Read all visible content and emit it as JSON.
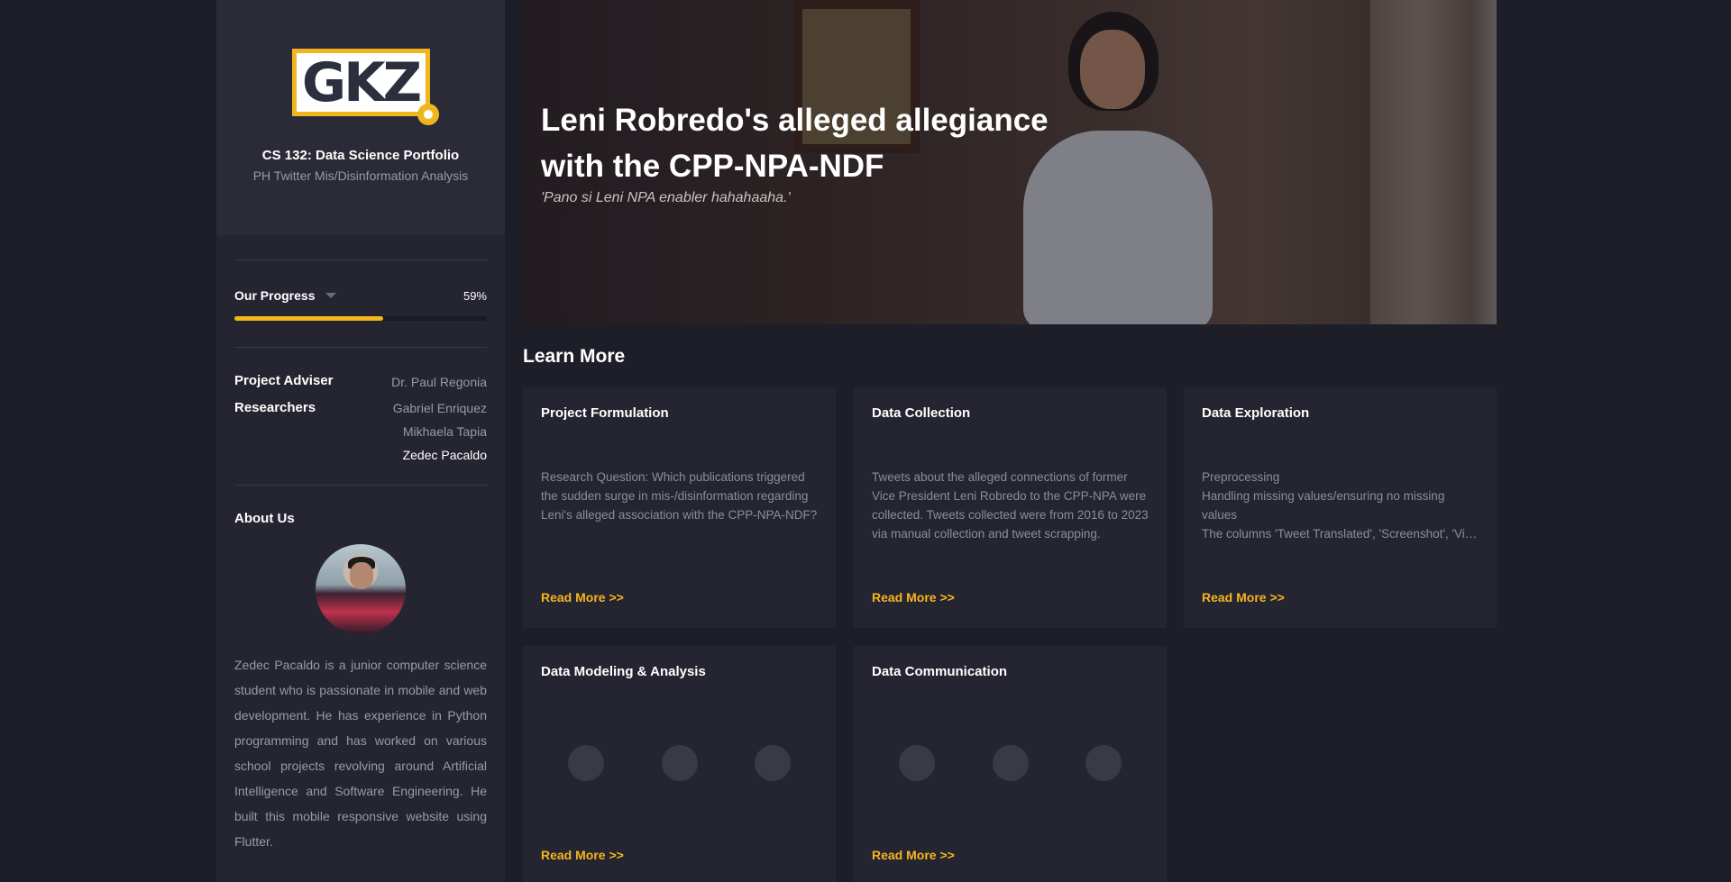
{
  "sidebar": {
    "logo_text": "GKZ",
    "course_title": "CS 132: Data Science Portfolio",
    "course_subtitle": "PH Twitter Mis/Disinformation Analysis",
    "progress": {
      "label": "Our Progress",
      "percent_text": "59%",
      "value": 59
    },
    "adviser": {
      "label": "Project Adviser",
      "name": "Dr. Paul Regonia"
    },
    "researchers": {
      "label": "Researchers",
      "names": [
        "Gabriel Enriquez",
        "Mikhaela Tapia",
        "Zedec Pacaldo"
      ]
    },
    "about": {
      "title": "About Us",
      "text": "Zedec Pacaldo is a junior computer science student who is passionate in mobile and web development. He has experience in Python programming and has worked on various school projects revolving around Artificial Intelligence and Software Engineering. He built this mobile responsive website using Flutter."
    }
  },
  "hero": {
    "title": "Leni Robredo's alleged allegiance with the CPP-NPA-NDF",
    "quote": "'Pano si Leni NPA enabler hahahaaha.'"
  },
  "learn_more": {
    "title": "Learn More",
    "read_more": "Read More >>",
    "cards": [
      {
        "title": "Project Formulation",
        "desc": "Research Question: Which publications triggered the sudden surge in mis-/disinformation regarding Leni's alleged association with the CPP-NPA-NDF?"
      },
      {
        "title": "Data Collection",
        "desc": "Tweets about the alleged connections of former Vice President Leni Robredo to the CPP-NPA were collected. Tweets collected were from 2016 to 2023 via manual collection and tweet scrapping."
      },
      {
        "title": "Data Exploration",
        "desc_lines": [
          "Preprocessing",
          "Handling missing values/ensuring no missing values",
          "The columns 'Tweet Translated', 'Screenshot', 'Views' contain missing values."
        ]
      },
      {
        "title": "Data Modeling & Analysis"
      },
      {
        "title": "Data Communication"
      }
    ]
  },
  "colors": {
    "accent": "#f5b51d",
    "background": "#1e1e28",
    "panel": "#252531"
  }
}
